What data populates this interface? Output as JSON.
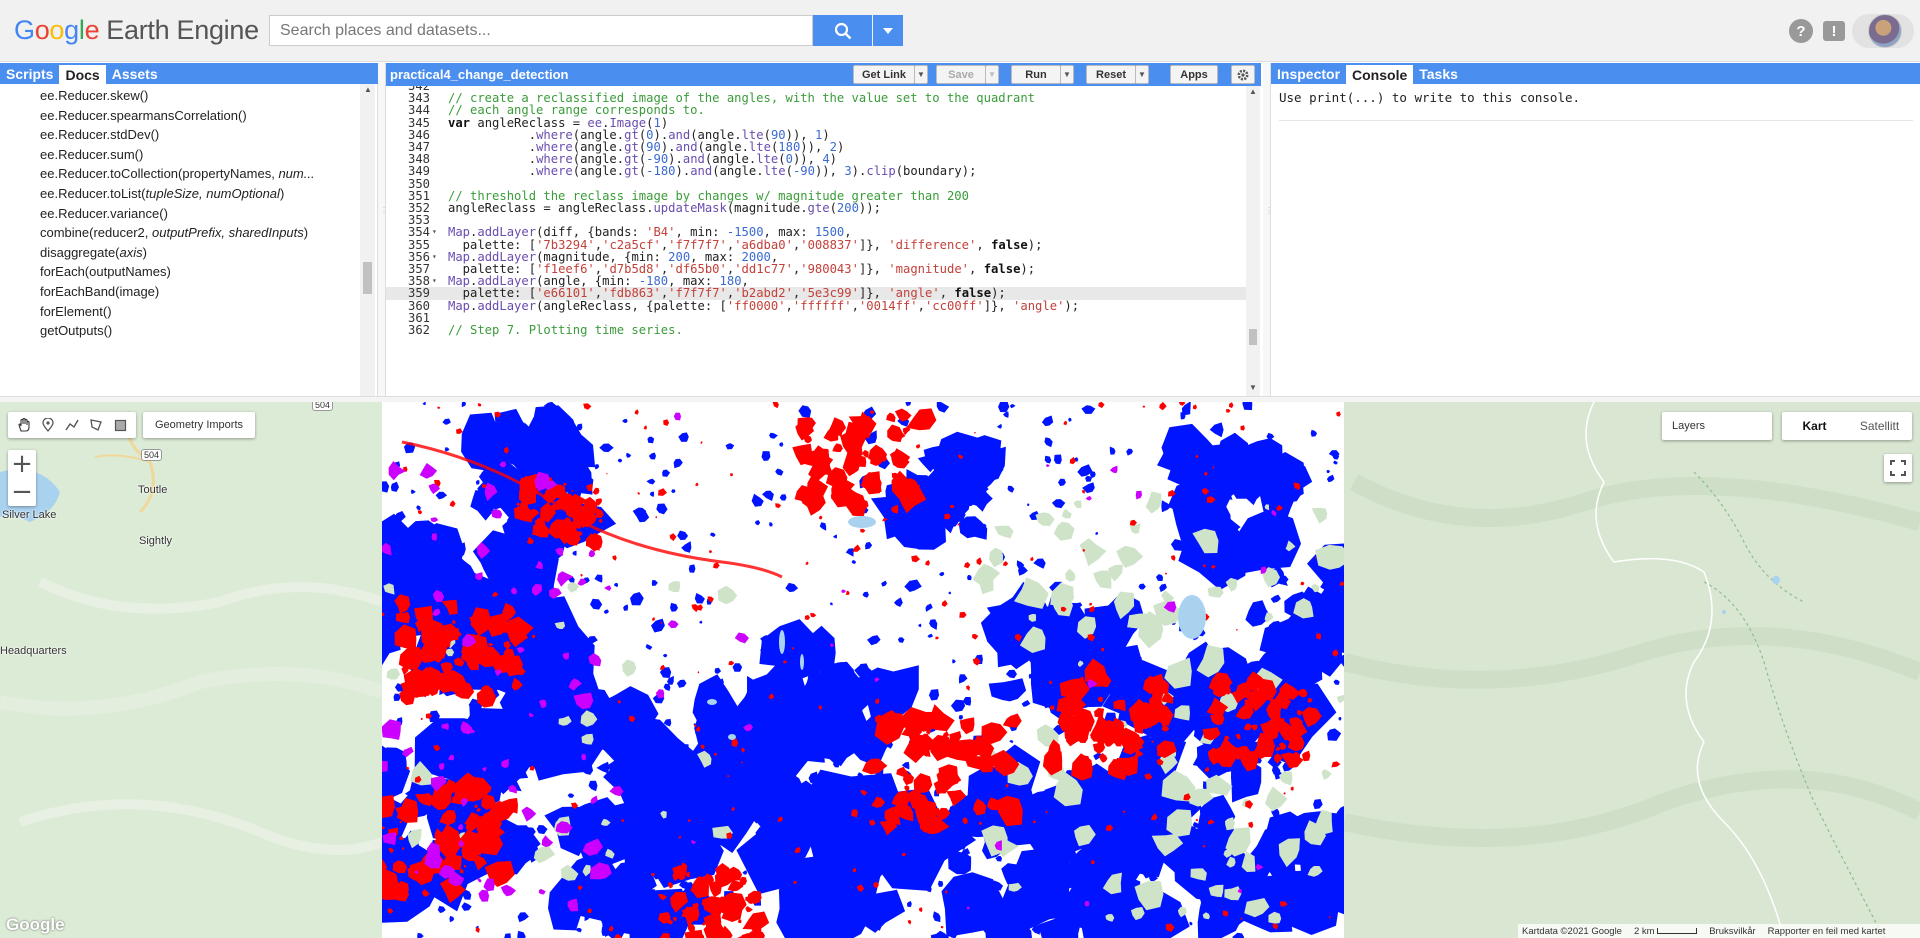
{
  "header": {
    "logo_google": [
      "G",
      "o",
      "o",
      "g",
      "l",
      "e"
    ],
    "logo_product": "Earth Engine",
    "search_placeholder": "Search places and datasets...",
    "help_icon": "?",
    "feedback_icon": "!"
  },
  "left_panel": {
    "tabs": [
      {
        "label": "Scripts",
        "active": false
      },
      {
        "label": "Docs",
        "active": true
      },
      {
        "label": "Assets",
        "active": false
      }
    ],
    "docs": [
      {
        "name": "ee.Reducer.skew()",
        "args": ""
      },
      {
        "name": "ee.Reducer.spearmansCorrelation()",
        "args": ""
      },
      {
        "name": "ee.Reducer.stdDev()",
        "args": ""
      },
      {
        "name": "ee.Reducer.sum()",
        "args": ""
      },
      {
        "name": "ee.Reducer.toCollection(propertyNames, ",
        "args": "num..."
      },
      {
        "name": "ee.Reducer.toList(",
        "args": "tupleSize, numOptional",
        "tail": ")"
      },
      {
        "name": "ee.Reducer.variance()",
        "args": ""
      },
      {
        "name": "combine(reducer2, ",
        "args": "outputPrefix, sharedInputs",
        "tail": ")"
      },
      {
        "name": "disaggregate(",
        "args": "axis",
        "tail": ")"
      },
      {
        "name": "forEach(outputNames)",
        "args": ""
      },
      {
        "name": "forEachBand(image)",
        "args": ""
      },
      {
        "name": "forElement()",
        "args": ""
      },
      {
        "name": "getOutputs()",
        "args": ""
      }
    ]
  },
  "editor": {
    "script_name": "practical4_change_detection",
    "buttons": {
      "get_link": "Get Link",
      "save": "Save",
      "run": "Run",
      "reset": "Reset",
      "apps": "Apps"
    },
    "lines": [
      {
        "n": "342",
        "fold": "",
        "html": ""
      },
      {
        "n": "343",
        "fold": "",
        "html": "<span class='c-com'>// create a reclassified image of the angles, with the value set to the quadrant</span>"
      },
      {
        "n": "344",
        "fold": "",
        "html": "<span class='c-com'>// each angle range corresponds to.</span>"
      },
      {
        "n": "345",
        "fold": "",
        "html": "<span class='c-kw'>var</span> angleReclass = <span class='c-ee'>ee</span>.<span class='c-fn'>Image</span>(<span class='c-num'>1</span>)"
      },
      {
        "n": "346",
        "fold": "",
        "html": "           .<span class='c-fn'>where</span>(angle.<span class='c-fn'>gt</span>(<span class='c-num'>0</span>).<span class='c-fn'>and</span>(angle.<span class='c-fn'>lte</span>(<span class='c-num'>90</span>)), <span class='c-num'>1</span>)"
      },
      {
        "n": "347",
        "fold": "",
        "html": "           .<span class='c-fn'>where</span>(angle.<span class='c-fn'>gt</span>(<span class='c-num'>90</span>).<span class='c-fn'>and</span>(angle.<span class='c-fn'>lte</span>(<span class='c-num'>180</span>)), <span class='c-num'>2</span>)"
      },
      {
        "n": "348",
        "fold": "",
        "html": "           .<span class='c-fn'>where</span>(angle.<span class='c-fn'>gt</span>(<span class='c-num'>-90</span>).<span class='c-fn'>and</span>(angle.<span class='c-fn'>lte</span>(<span class='c-num'>0</span>)), <span class='c-num'>4</span>)"
      },
      {
        "n": "349",
        "fold": "",
        "html": "           .<span class='c-fn'>where</span>(angle.<span class='c-fn'>gt</span>(<span class='c-num'>-180</span>).<span class='c-fn'>and</span>(angle.<span class='c-fn'>lte</span>(<span class='c-num'>-90</span>)), <span class='c-num'>3</span>).<span class='c-fn'>clip</span>(boundary);"
      },
      {
        "n": "350",
        "fold": "",
        "html": ""
      },
      {
        "n": "351",
        "fold": "",
        "html": "<span class='c-com'>// threshold the reclass image by changes w/ magnitude greater than 200</span>"
      },
      {
        "n": "352",
        "fold": "",
        "html": "angleReclass = angleReclass.<span class='c-fn'>updateMask</span>(magnitude.<span class='c-fn'>gte</span>(<span class='c-num'>200</span>));"
      },
      {
        "n": "353",
        "fold": "",
        "html": ""
      },
      {
        "n": "354",
        "fold": "▾",
        "html": "<span class='c-fn'>Map</span>.<span class='c-fn'>addLayer</span>(diff, {bands: <span class='c-str'>'B4'</span>, min: <span class='c-num'>-1500</span>, max: <span class='c-num'>1500</span>,"
      },
      {
        "n": "355",
        "fold": "",
        "html": "  palette: [<span class='c-str'>'7b3294'</span>,<span class='c-str'>'c2a5cf'</span>,<span class='c-str'>'f7f7f7'</span>,<span class='c-str'>'a6dba0'</span>,<span class='c-str'>'008837'</span>]}, <span class='c-str'>'difference'</span>, <span class='c-bool'>false</span>);"
      },
      {
        "n": "356",
        "fold": "▾",
        "html": "<span class='c-fn'>Map</span>.<span class='c-fn'>addLayer</span>(magnitude, {min: <span class='c-num'>200</span>, max: <span class='c-num'>2000</span>,"
      },
      {
        "n": "357",
        "fold": "",
        "html": "  palette: [<span class='c-str'>'f1eef6'</span>,<span class='c-str'>'d7b5d8'</span>,<span class='c-str'>'df65b0'</span>,<span class='c-str'>'dd1c77'</span>,<span class='c-str'>'980043'</span>]}, <span class='c-str'>'magnitude'</span>, <span class='c-bool'>false</span>);"
      },
      {
        "n": "358",
        "fold": "▾",
        "html": "<span class='c-fn'>Map</span>.<span class='c-fn'>addLayer</span>(angle, {min: <span class='c-num'>-180</span>, max: <span class='c-num'>180</span>,"
      },
      {
        "n": "359",
        "fold": "",
        "html": "  palette: [<span class='c-str'>'e66101'</span>,<span class='c-str'>'fdb863'</span>,<span class='c-str'>'f7f7f7'</span>,<span class='c-str'>'b2abd2'</span>,<span class='c-str'>'5e3c99'</span>]}, <span class='c-str'>'angle'</span>, <span class='c-bool'>false</span>);",
        "hl": true
      },
      {
        "n": "360",
        "fold": "",
        "html": "<span class='c-fn'>Map</span>.<span class='c-fn'>addLayer</span>(angleReclass, {palette: [<span class='c-str'>'ff0000'</span>,<span class='c-str'>'ffffff'</span>,<span class='c-str'>'0014ff'</span>,<span class='c-str'>'cc00ff'</span>]}, <span class='c-str'>'angle'</span>);"
      },
      {
        "n": "361",
        "fold": "",
        "html": ""
      },
      {
        "n": "362",
        "fold": "",
        "html": "<span class='c-com'>// Step 7. Plotting time series.</span>"
      }
    ]
  },
  "console_panel": {
    "tabs": [
      {
        "label": "Inspector",
        "active": false
      },
      {
        "label": "Console",
        "active": true
      },
      {
        "label": "Tasks",
        "active": false
      }
    ],
    "message": "Use print(...) to write to this console."
  },
  "map": {
    "geometry_imports": "Geometry Imports",
    "layers_label": "Layers",
    "map_types": [
      {
        "label": "Kart",
        "active": true
      },
      {
        "label": "Satellitt",
        "active": false
      }
    ],
    "zoom_in": "+",
    "zoom_out": "−",
    "places": [
      "Silver Lake",
      "Toutle",
      "Sightly",
      "Headquarters"
    ],
    "road_shields": [
      "504",
      "504"
    ],
    "google_mark": "Google",
    "attribution": {
      "data": "Kartdata ©2021 Google",
      "scale": "2 km",
      "terms": "Bruksvilkår",
      "report": "Rapporter en feil med kartet"
    },
    "reclass_colors": {
      "quadrant_1": "#ff0000",
      "quadrant_2": "#ffffff",
      "quadrant_3": "#0014ff",
      "quadrant_4": "#cc00ff"
    }
  }
}
